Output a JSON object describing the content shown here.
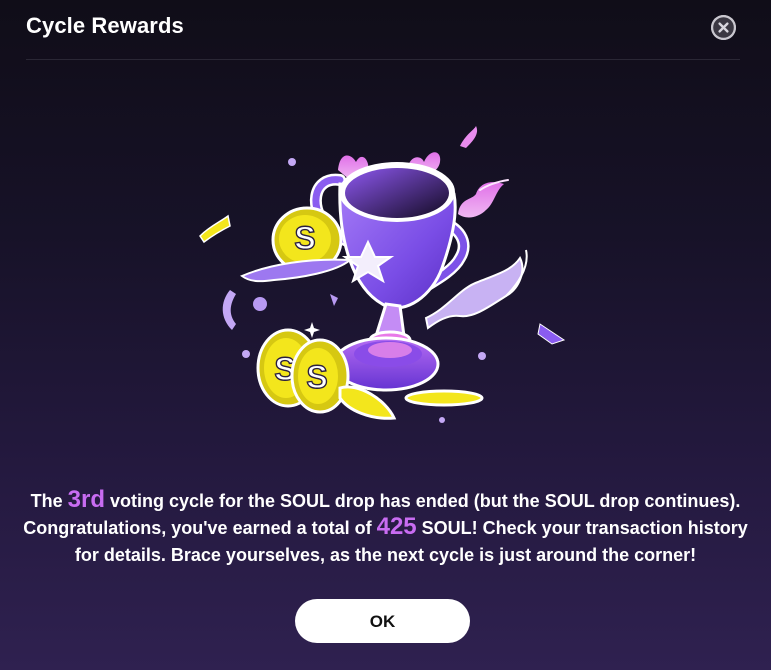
{
  "dialog": {
    "title": "Cycle Rewards",
    "close_icon": "close-icon"
  },
  "illustration": {
    "icon": "trophy-icon",
    "coin_letter": "S",
    "colors": {
      "trophy": "#8a5cf0",
      "coin": "#f2e21a",
      "confetti": "#c4a8f5",
      "accent": "#c86cf2"
    }
  },
  "message": {
    "part1": "The ",
    "cycle": "3rd",
    "part2": " voting cycle for the SOUL drop has ended (but the SOUL drop continues).",
    "part3": "Congratulations, you've earned a total of ",
    "amount": "425",
    "part4": " SOUL! Check your transaction history",
    "part5": "for details. Brace yourselves, as the next cycle is just around the corner!"
  },
  "actions": {
    "ok_label": "OK"
  }
}
